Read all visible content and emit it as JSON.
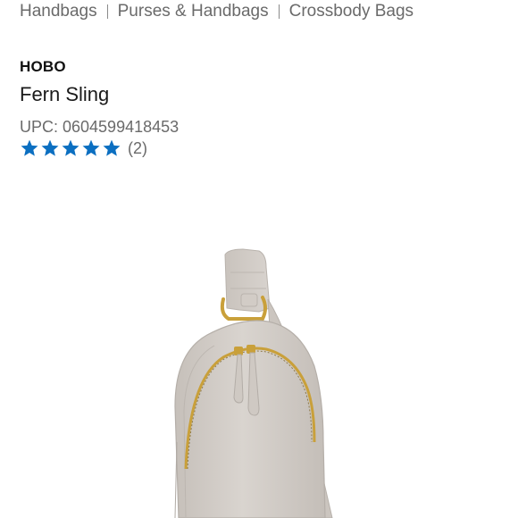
{
  "breadcrumb": {
    "items": [
      "Handbags",
      "Purses & Handbags",
      "Crossbody Bags"
    ]
  },
  "product": {
    "brand": "HOBO",
    "title": "Fern Sling",
    "upc_label": "UPC: 0604599418453",
    "rating": {
      "stars": 5,
      "max_stars": 5,
      "review_count_label": "(2)",
      "star_color": "#0b6fc1"
    },
    "image": {
      "subject": "taupe leather sling bag with gold zipper",
      "bag_color": "#d4cec8",
      "hardware_color": "#c9a03a"
    }
  }
}
